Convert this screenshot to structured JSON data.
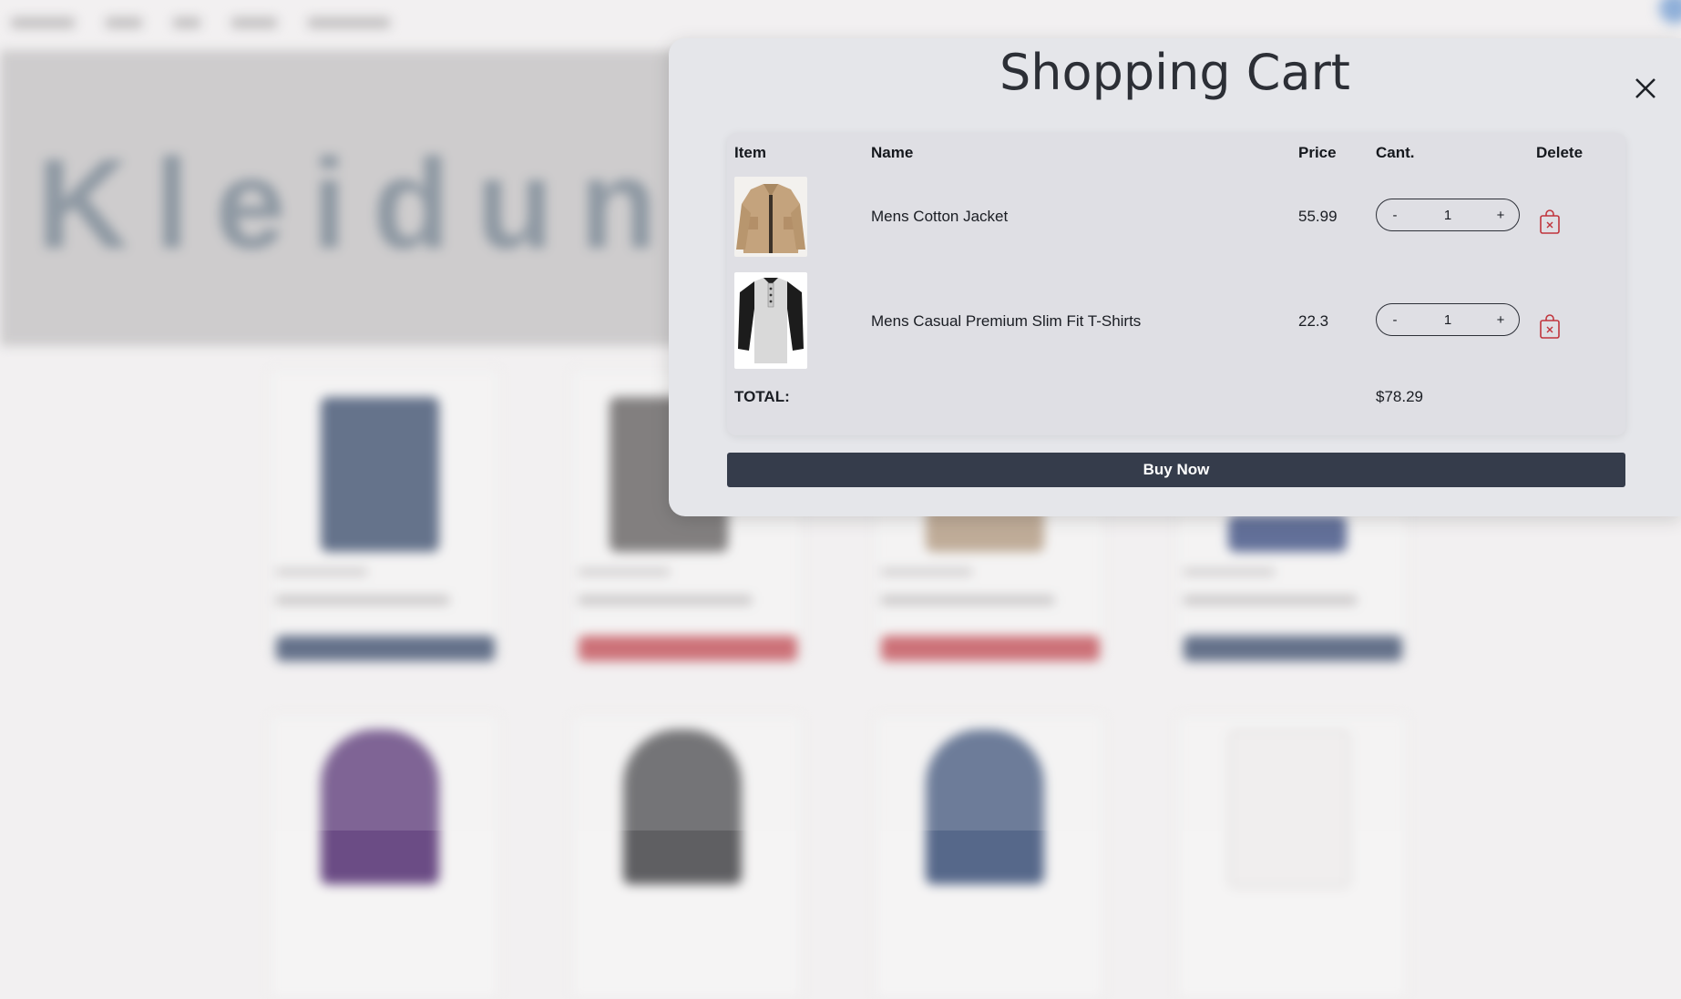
{
  "background": {
    "hero_title": "Kleidung"
  },
  "cart": {
    "title": "Shopping Cart",
    "columns": {
      "item": "Item",
      "name": "Name",
      "price": "Price",
      "qty": "Cant.",
      "delete": "Delete"
    },
    "items": [
      {
        "name": "Mens Cotton Jacket",
        "price": "55.99",
        "qty": "1",
        "minus": "-",
        "plus": "+"
      },
      {
        "name": "Mens Casual Premium Slim Fit T-Shirts",
        "price": "22.3",
        "qty": "1",
        "minus": "-",
        "plus": "+"
      }
    ],
    "total_label": "TOTAL:",
    "total_value": "$78.29",
    "buy_label": "Buy Now",
    "accent_color": "#353c4b",
    "delete_color": "#c0343c"
  }
}
